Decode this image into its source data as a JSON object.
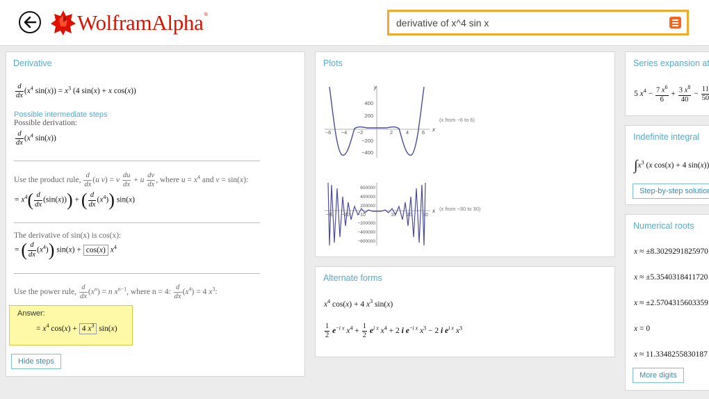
{
  "header": {
    "logo_text": "WolframAlpha",
    "search_value": "derivative of x^4 sin x"
  },
  "derivative": {
    "title": "Derivative",
    "possible_intermediate_steps": "Possible intermediate steps",
    "possible_derivation": "Possible derivation:",
    "product_rule_text": "Use the product rule,",
    "where_text": ", where",
    "and_text": "and",
    "derivative_of_sin_text": "The derivative of sin(x) is cos(x):",
    "power_rule_text": "Use the power rule,",
    "where_n_text": ", where n = 4:",
    "answer_label": "Answer:",
    "hide_steps": "Hide steps"
  },
  "plots": {
    "title": "Plots",
    "plot1_range": "(x from −6 to 6)",
    "plot2_range": "(x from −30 to 30)",
    "plot1_yticks": [
      "400",
      "200",
      "−200",
      "−400"
    ],
    "plot1_xticks": [
      "−6",
      "−4",
      "−2",
      "2",
      "4",
      "6"
    ],
    "plot2_yticks": [
      "600000",
      "400000",
      "200000",
      "−200000",
      "−400000",
      "−600000"
    ],
    "plot2_xticks": [
      "−30",
      "−20",
      "−10",
      "10",
      "20",
      "30"
    ],
    "axis_x": "x",
    "axis_y": "y"
  },
  "alternate_forms": {
    "title": "Alternate forms"
  },
  "series": {
    "title": "Series expansion at x"
  },
  "indefinite": {
    "title": "Indefinite integral",
    "button": "Step-by-step solution"
  },
  "roots": {
    "title": "Numerical roots",
    "values": [
      "±8.3029291825970",
      "±5.3540318411720",
      "±2.5704315603359",
      "0",
      "11.3348255830187"
    ],
    "approx": [
      "≈",
      "≈",
      "≈",
      "=",
      "≈"
    ],
    "button": "More digits"
  },
  "colors": {
    "accent": "#5ba9c9",
    "brand": "#dd1100",
    "search_border": "#f0a92b",
    "answer_bg": "#fdf9a6",
    "plot_curve": "#4a4a9a"
  }
}
